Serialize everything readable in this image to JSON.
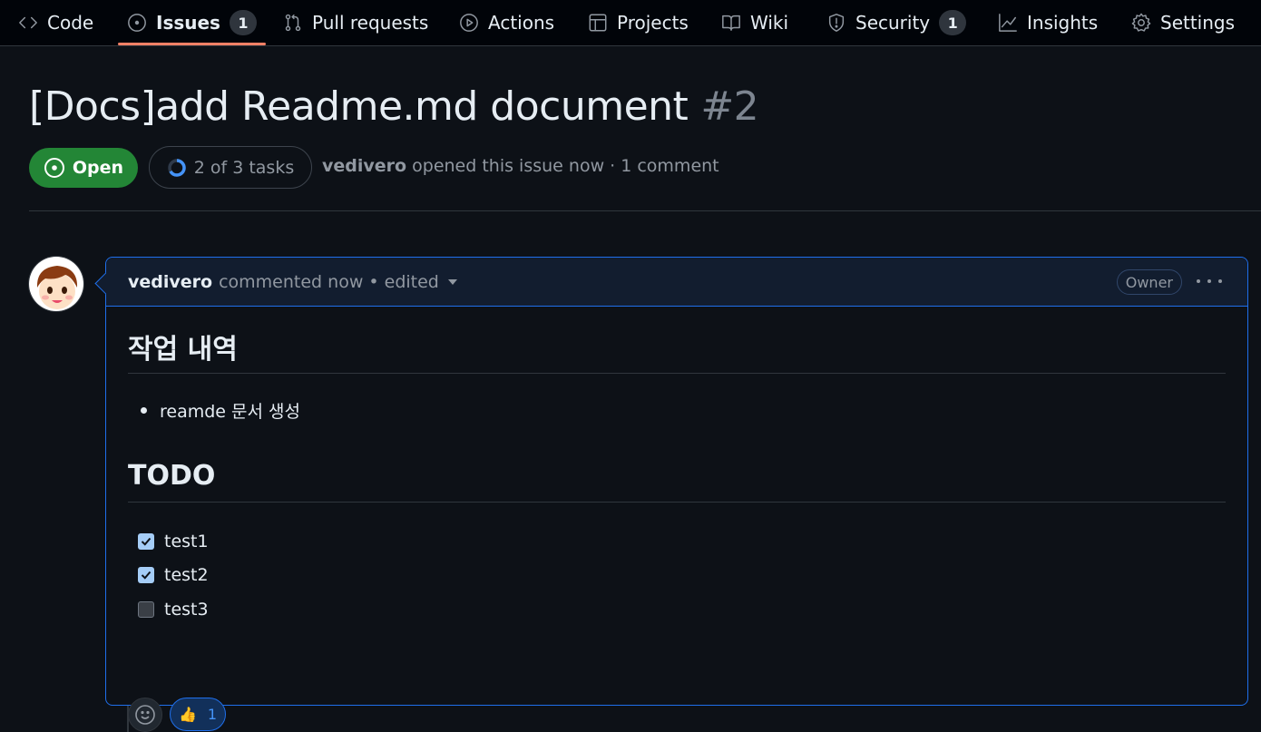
{
  "nav": {
    "items": [
      {
        "label": "Code",
        "icon": "code-icon"
      },
      {
        "label": "Issues",
        "icon": "issue-opened-icon",
        "count": "1"
      },
      {
        "label": "Pull requests",
        "icon": "git-pull-request-icon"
      },
      {
        "label": "Actions",
        "icon": "play-icon"
      },
      {
        "label": "Projects",
        "icon": "table-icon"
      },
      {
        "label": "Wiki",
        "icon": "book-icon"
      },
      {
        "label": "Security",
        "icon": "shield-icon",
        "count": "1"
      },
      {
        "label": "Insights",
        "icon": "graph-icon"
      },
      {
        "label": "Settings",
        "icon": "gear-icon"
      }
    ],
    "active": "Issues",
    "active_underline_color": "#f78166"
  },
  "issue": {
    "title": "[Docs]add Readme.md document",
    "number": "#2",
    "state": "Open",
    "state_color": "#238636",
    "tasks": "2 of 3 tasks",
    "tasks_progress": 0.667,
    "author": "vedivero",
    "meta": "opened this issue now · 1 comment"
  },
  "comment": {
    "author": "vedivero",
    "meta": "commented now • edited",
    "role_badge": "Owner",
    "heading1": "작업 내역",
    "bullet": "reamde 문서 생성",
    "heading2": "TODO",
    "tasks": [
      {
        "label": "test1",
        "checked": true
      },
      {
        "label": "test2",
        "checked": true
      },
      {
        "label": "test3",
        "checked": false
      }
    ],
    "reaction": {
      "emoji": "👍",
      "count": "1"
    }
  }
}
